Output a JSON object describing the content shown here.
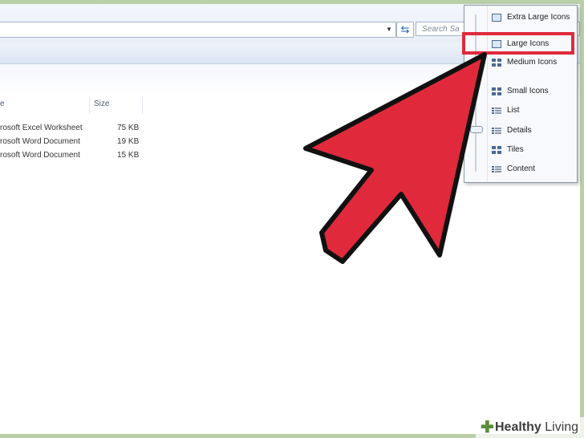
{
  "address_bar": {
    "search_placeholder": "Search Sa",
    "dropdown_glyph": "▼",
    "refresh_glyph": "⇆"
  },
  "file_list": {
    "columns": [
      "e",
      "Size"
    ],
    "rows": [
      {
        "type": "rosoft Excel Worksheet",
        "size": "75 KB"
      },
      {
        "type": "rosoft Word Document",
        "size": "19 KB"
      },
      {
        "type": "rosoft Word Document",
        "size": "15 KB"
      }
    ]
  },
  "view_menu": {
    "items": [
      {
        "label": "Extra Large Icons",
        "icon": "extra-large-icons-icon"
      },
      {
        "label": "Large Icons",
        "icon": "large-icons-icon",
        "highlighted": true
      },
      {
        "label": "Medium Icons",
        "icon": "medium-icons-icon"
      },
      {
        "label": "Small Icons",
        "icon": "small-icons-icon"
      },
      {
        "label": "List",
        "icon": "list-icon"
      },
      {
        "label": "Details",
        "icon": "details-icon"
      },
      {
        "label": "Tiles",
        "icon": "tiles-icon"
      },
      {
        "label": "Content",
        "icon": "content-icon"
      }
    ],
    "selected": "Large Icons"
  },
  "annotation": {
    "highlight_color": "#e02a3b",
    "arrow_color": "#e02a3b"
  },
  "watermark": {
    "brand_bold": "Healthy",
    "brand_rest": " Living"
  },
  "colors": {
    "background": "#b9cfa8",
    "accent": "#1b5fb5"
  }
}
